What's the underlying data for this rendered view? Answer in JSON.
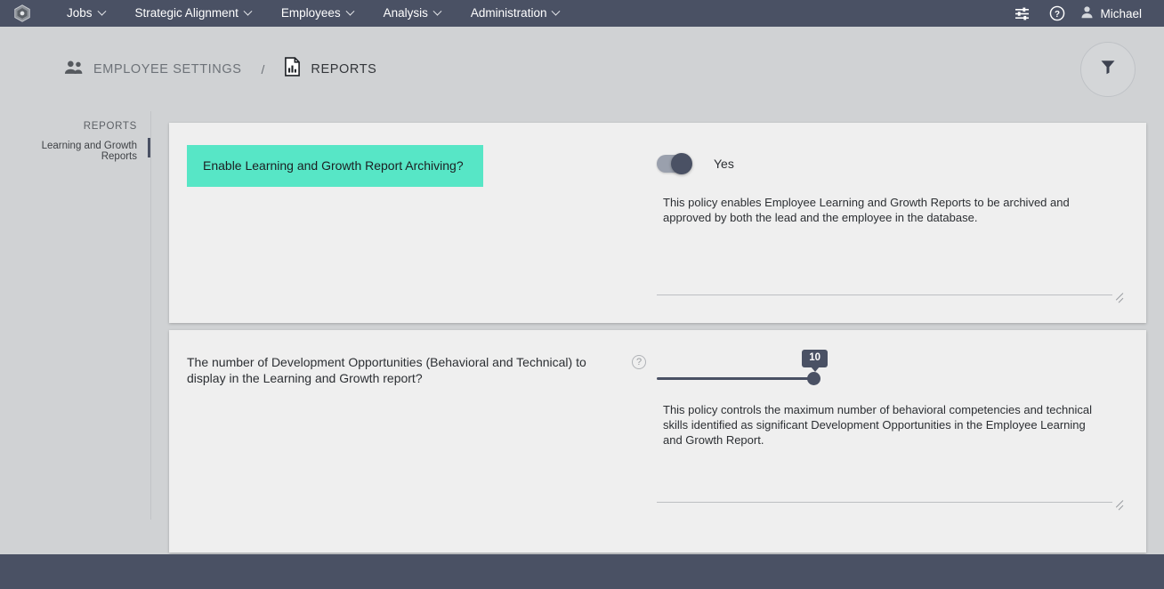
{
  "topnav": {
    "logo_icon": "hexagon-logo-icon",
    "items": [
      {
        "label": "Jobs",
        "has_caret": true
      },
      {
        "label": "Strategic Alignment",
        "has_caret": true
      },
      {
        "label": "Employees",
        "has_caret": true
      },
      {
        "label": "Analysis",
        "has_caret": true
      },
      {
        "label": "Administration",
        "has_caret": true
      }
    ],
    "right": {
      "tune_icon": "sliders-icon",
      "help_icon": "help-circle-icon",
      "user_icon": "user-avatar-icon",
      "user_name": "Michael"
    }
  },
  "breadcrumb": {
    "items": [
      {
        "label": "EMPLOYEE SETTINGS",
        "icon": "people-icon",
        "active": false
      },
      {
        "label": "REPORTS",
        "icon": "report-chart-icon",
        "active": true
      }
    ],
    "separator": "/",
    "filter_icon": "funnel-filter-icon"
  },
  "sidebar": {
    "title": "REPORTS",
    "items": [
      {
        "label": "Learning and Growth Reports",
        "selected": true
      }
    ]
  },
  "cards": [
    {
      "label": "Enable Learning and Growth Report Archiving?",
      "toggle": {
        "state": "on",
        "value_label": "Yes"
      },
      "description": "This policy enables Employee Learning and Growth Reports to be archived and approved by both the lead and the employee in the database."
    },
    {
      "label": "The number of Development Opportunities (Behavioral and Technical) to display in the Learning and Growth report?",
      "help_icon_label": "?",
      "slider": {
        "value": "10",
        "min": 0,
        "max": 10,
        "fill_percent": 100
      },
      "description": "This policy controls the maximum number of behavioral competencies and technical skills identified as significant Development Opportunities in the Employee Learning and Growth Report."
    }
  ],
  "colors": {
    "navbar": "#4a5164",
    "page_bg": "#d0d2d4",
    "card_bg": "#efefef",
    "highlight": "#57e6c6",
    "accent_dark": "#4a5164"
  }
}
